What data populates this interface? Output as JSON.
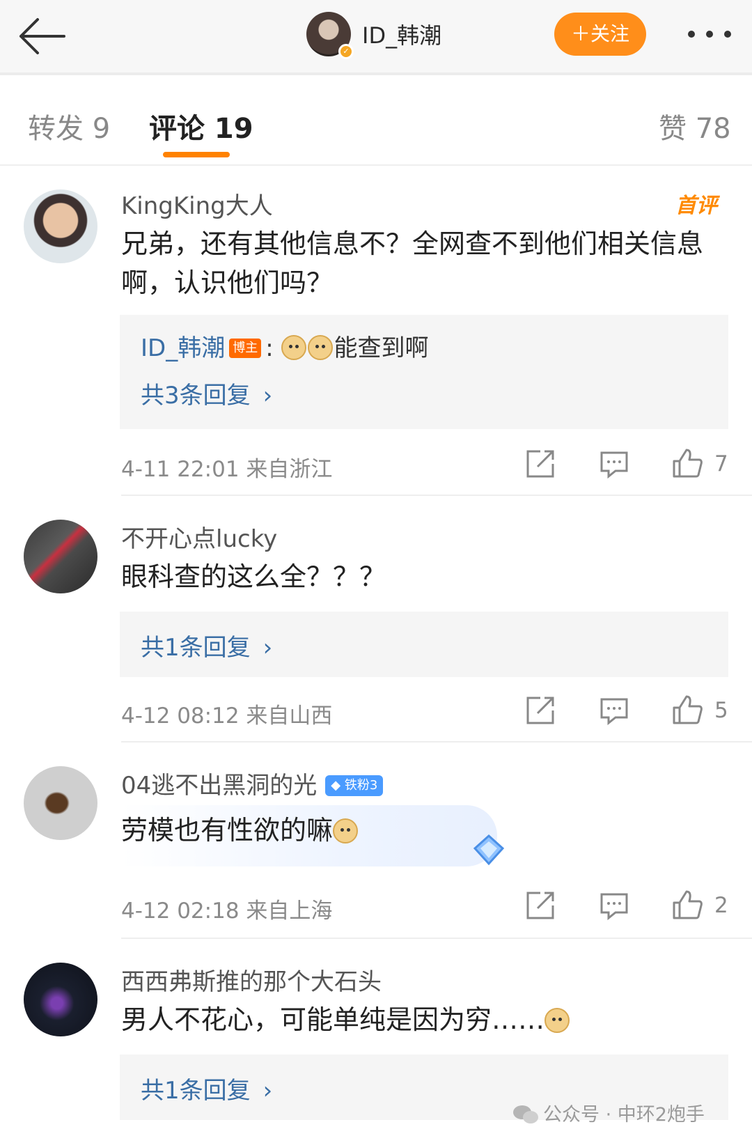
{
  "header": {
    "author_name": "ID_韩潮",
    "follow_label": "＋关注"
  },
  "tabs": [
    {
      "label": "转发 9"
    },
    {
      "label": "评论 19"
    },
    {
      "label": "赞 78"
    }
  ],
  "comments": [
    {
      "user": "KingKing大人",
      "badge": "首评",
      "text": "兄弟，还有其他信息不？全网查不到他们相关信息啊，认识他们吗？",
      "reply": {
        "author": "ID_韩潮",
        "host_tag": "博主",
        "sep": ":",
        "text": "能查到啊",
        "more": "共3条回复"
      },
      "meta": "4-11 22:01  来自浙江",
      "likes": "7"
    },
    {
      "user": "不开心点lucky",
      "text": "眼科查的这么全？？？",
      "reply": {
        "more": "共1条回复"
      },
      "meta": "4-12 08:12  来自山西",
      "likes": "5"
    },
    {
      "user": "04逃不出黑洞的光",
      "fan_badge": "铁粉3",
      "text": "劳模也有性欲的嘛",
      "meta": "4-12 02:18  来自上海",
      "likes": "2"
    },
    {
      "user": "西西弗斯推的那个大石头",
      "text": "男人不花心，可能单纯是因为穷……",
      "reply": {
        "more": "共1条回复"
      }
    }
  ],
  "watermark": "公众号 · 中环2炮手",
  "colors": {
    "accent": "#ff8200",
    "link": "#3a6ea5",
    "follow": "#ff8e1a"
  }
}
